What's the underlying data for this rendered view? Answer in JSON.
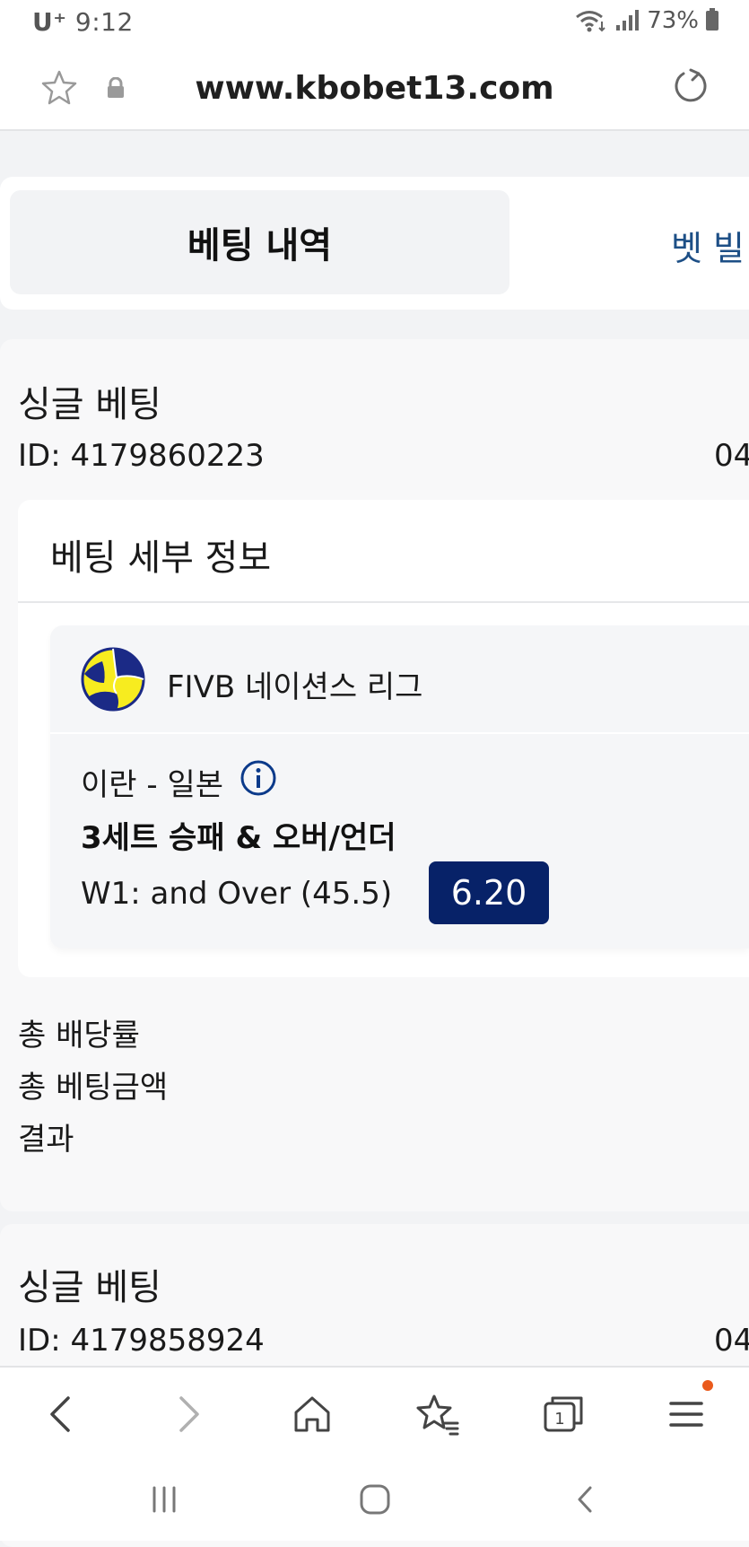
{
  "status_bar": {
    "carrier": "U⁺",
    "time": "9:12",
    "battery": "73%"
  },
  "browser": {
    "url": "www.kbobet13.com"
  },
  "tabs": {
    "active_label": "베팅 내역",
    "other_label": "벳 빌"
  },
  "bets": [
    {
      "title": "싱글 베팅",
      "id": "ID: 4179860223",
      "date_partial": "04",
      "details_title": "베팅 세부 정보",
      "league": "FIVB 네이션스 리그",
      "match": "이란 - 일본",
      "market": "3세트 승패 & 오버/언더",
      "selection": "W1: and Over (45.5)",
      "odds": "6.20",
      "summary_labels": [
        "총 배당률",
        "총 베팅금액",
        "결과"
      ]
    },
    {
      "title": "싱글 베팅",
      "id": "ID: 4179858924",
      "date_partial": "04"
    }
  ],
  "icons": {
    "favorite": "star-icon",
    "secure": "lock-icon",
    "reload": "reload-icon",
    "sport": "volleyball-icon",
    "info": "info-icon",
    "nav": [
      "back-icon",
      "forward-icon",
      "home-icon",
      "bookmarks-icon",
      "tabs-icon",
      "menu-icon"
    ],
    "system": [
      "recents-icon",
      "home-circle-icon",
      "system-back-icon"
    ]
  },
  "tabs_count": "1",
  "colors": {
    "odds_bg": "#072268",
    "tab_link": "#1d4f86",
    "notification_dot": "#ea5a1c"
  }
}
